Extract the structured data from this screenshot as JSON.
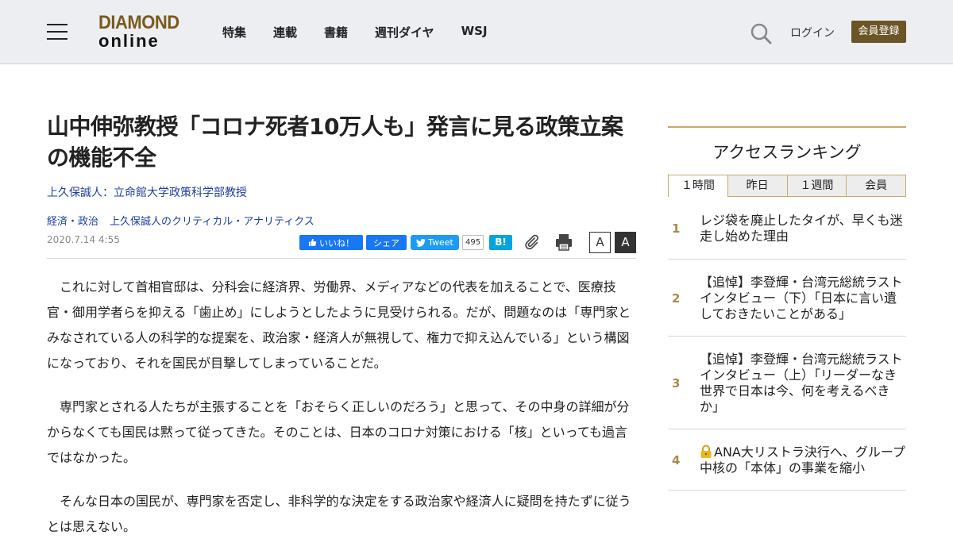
{
  "header": {
    "logo_top": "DIAMOND",
    "logo_bottom": "online",
    "nav": [
      "特集",
      "連載",
      "書籍",
      "週刊ダイヤ",
      "WSJ"
    ],
    "login": "ログイン",
    "register": "会員登録"
  },
  "article": {
    "title": "山中伸弥教授「コロナ死者10万人も」発言に見る政策立案の機能不全",
    "author": "上久保誠人：立命館大学政策科学部教授",
    "categories": [
      "経済・政治",
      "上久保誠人のクリティカル・アナリティクス"
    ],
    "date": "2020.7.14 4:55",
    "share": {
      "like": "いいね！",
      "fb_share": "シェア",
      "tweet": "Tweet",
      "tweet_count": "495",
      "hatena": "B!"
    },
    "font_small": "A",
    "font_large": "A",
    "paragraphs": [
      "これに対して首相官邸は、分科会に経済界、労働界、メディアなどの代表を加えることで、医療技官・御用学者らを抑える「歯止め」にしようとしたように見受けられる。だが、問題なのは「専門家とみなされている人の科学的な提案を、政治家・経済人が無視して、権力で抑え込んでいる」という構図になっており、それを国民が目撃してしまっていることだ。",
      "専門家とされる人たちが主張することを「おそらく正しいのだろう」と思って、その中身の詳細が分からなくても国民は黙って従ってきた。そのことは、日本のコロナ対策における「核」といっても過言ではなかった。",
      "そんな日本の国民が、専門家を否定し、非科学的な決定をする政治家や経済人に疑問を持たずに従うとは思えない。"
    ]
  },
  "sidebar": {
    "ranking_title": "アクセスランキング",
    "tabs": [
      "１時間",
      "昨日",
      "１週間",
      "会員"
    ],
    "items": [
      {
        "rank": "1",
        "text": "レジ袋を廃止したタイが、早くも迷走し始めた理由"
      },
      {
        "rank": "2",
        "text": "【追悼】李登輝・台湾元総統ラストインタビュー（下）「日本に言い遺しておきたいことがある」"
      },
      {
        "rank": "3",
        "text": "【追悼】李登輝・台湾元総統ラストインタビュー（上）「リーダーなき世界で日本は今、何を考えるべきか」"
      },
      {
        "rank": "4",
        "text": "ANA大リストラ決行へ、グループ中核の「本体」の事業を縮小"
      }
    ]
  },
  "colors": {
    "brand_gold": "#7a5a1c",
    "register_bg": "#6b5426",
    "link_blue": "#1d3fa0",
    "rank_accent": "#c8a96a"
  }
}
